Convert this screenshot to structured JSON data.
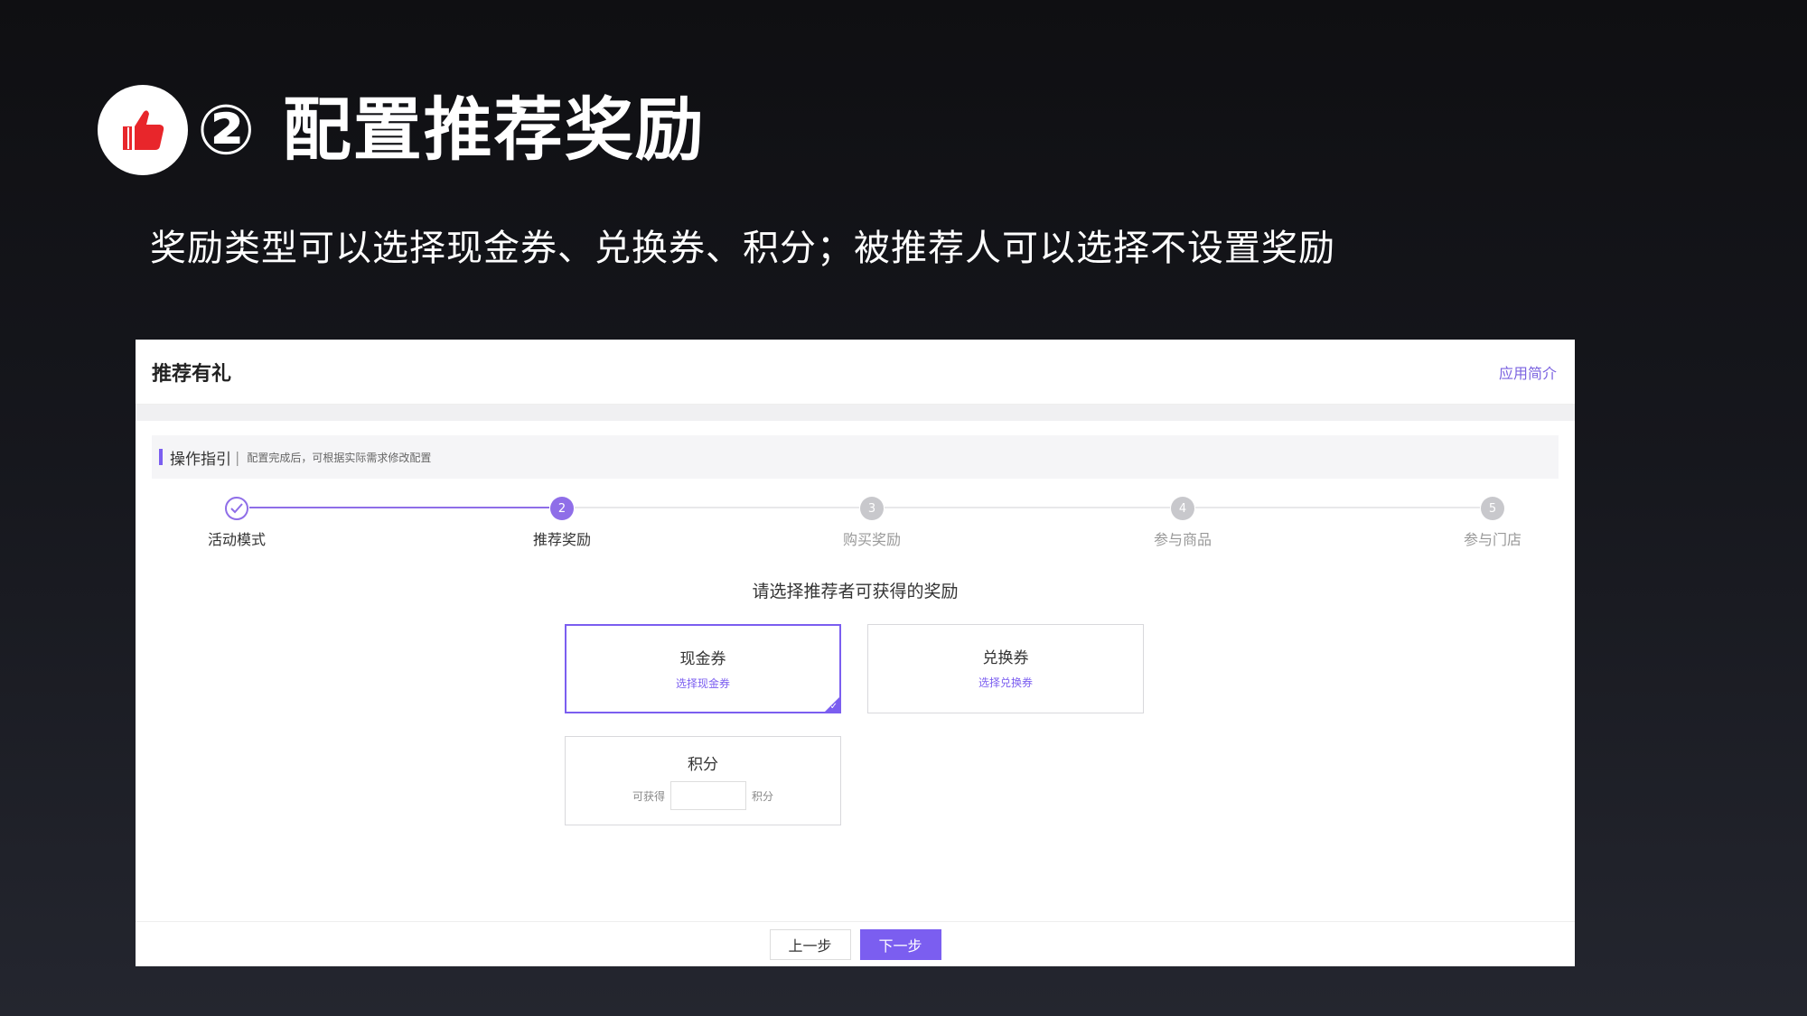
{
  "slide": {
    "title": "② 配置推荐奖励",
    "subtitle": "奖励类型可以选择现金券、兑换券、积分；被推荐人可以选择不设置奖励",
    "icon": "thumbs-up-icon"
  },
  "app": {
    "title": "推荐有礼",
    "intro_link": "应用简介"
  },
  "guide": {
    "title": "操作指引",
    "separator": "|",
    "desc": "配置完成后，可根据实际需求修改配置"
  },
  "steps": [
    {
      "num": "1",
      "label": "活动模式",
      "state": "finished"
    },
    {
      "num": "2",
      "label": "推荐奖励",
      "state": "active"
    },
    {
      "num": "3",
      "label": "购买奖励",
      "state": "pending"
    },
    {
      "num": "4",
      "label": "参与商品",
      "state": "pending"
    },
    {
      "num": "5",
      "label": "参与门店",
      "state": "pending"
    }
  ],
  "reward": {
    "prompt": "请选择推荐者可获得的奖励",
    "cash": {
      "title": "现金券",
      "link": "选择现金券",
      "selected": true
    },
    "exchange": {
      "title": "兑换券",
      "link": "选择兑换券",
      "selected": false
    },
    "points": {
      "title": "积分",
      "prefix": "可获得",
      "suffix": "积分",
      "value": ""
    }
  },
  "footer": {
    "prev_label": "上一步",
    "next_label": "下一步"
  },
  "colors": {
    "accent": "#7b5ef0",
    "thumb": "#e8262b"
  }
}
